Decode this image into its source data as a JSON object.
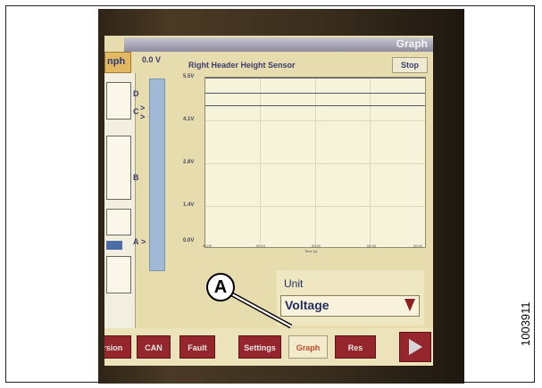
{
  "screen": {
    "title": "Graph",
    "left_tab_label": "nph",
    "voltage_readout": "0.0 V",
    "sensor_title": "Right Header Height Sensor",
    "stop_label": "Stop",
    "bar_levels": {
      "d": "D",
      "c": "C",
      "b": "B",
      "a": "A"
    },
    "level_marker": ">"
  },
  "chart_data": {
    "type": "line",
    "title": "Right Header Height Sensor",
    "xlabel": "Time (s)",
    "ylabel": "",
    "y_ticks": [
      "5.5V",
      "4.1V",
      "2.8V",
      "1.4V",
      "0.0V"
    ],
    "x_ticks": [
      "00:00",
      "00:10",
      "00:20",
      "00:30",
      "00:40"
    ],
    "ylim": [
      0,
      5.5
    ],
    "reference_levels": [
      5.5,
      5.0,
      4.6
    ],
    "grid": true
  },
  "unit_panel": {
    "label": "Unit",
    "selected": "Voltage"
  },
  "bottom_tabs": [
    {
      "label": "Version"
    },
    {
      "label": "CAN"
    },
    {
      "label": "Fault"
    },
    {
      "label": "Settings"
    },
    {
      "label": "Graph"
    },
    {
      "label": "Res"
    }
  ],
  "callout": "A",
  "figure_id": "1003911",
  "colors": {
    "screen_bg": "#e6dcae",
    "tab_red": "#95262e",
    "text_navy": "#1f2c5e",
    "bar_blue": "#9fb9d6"
  }
}
